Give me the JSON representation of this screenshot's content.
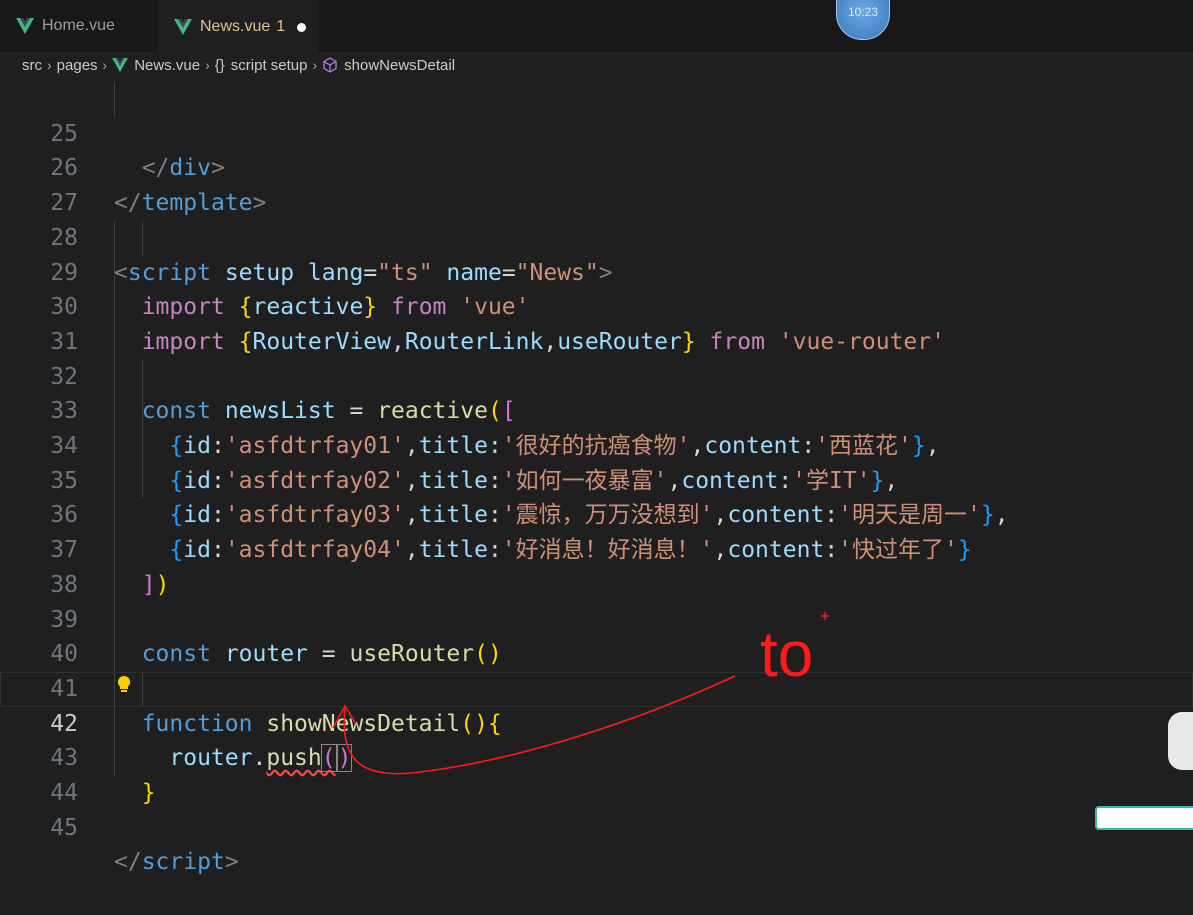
{
  "tabs": [
    {
      "label": "Home.vue",
      "icon": "vue-icon",
      "active": false
    },
    {
      "label": "News.vue",
      "icon": "vue-icon",
      "active": true,
      "error_count": "1",
      "dirty": true
    }
  ],
  "clock": "10:23",
  "breadcrumb": {
    "items": [
      "src",
      "pages",
      "News.vue",
      "script setup",
      "showNewsDetail"
    ],
    "braces": "{}"
  },
  "editor": {
    "current_line": 42,
    "line_numbers": [
      "25",
      "26",
      "27",
      "28",
      "29",
      "30",
      "31",
      "32",
      "33",
      "34",
      "35",
      "36",
      "37",
      "38",
      "39",
      "40",
      "41",
      "42",
      "43",
      "44",
      "45"
    ]
  },
  "annotation": {
    "text": "to",
    "color": "#ff1a1a"
  },
  "colors": {
    "keyword": "#569cd6",
    "import": "#c586c0",
    "string": "#ce9178",
    "variable": "#9cdcfe",
    "function": "#dcdcaa",
    "modified_tab": "#e2c08d"
  }
}
